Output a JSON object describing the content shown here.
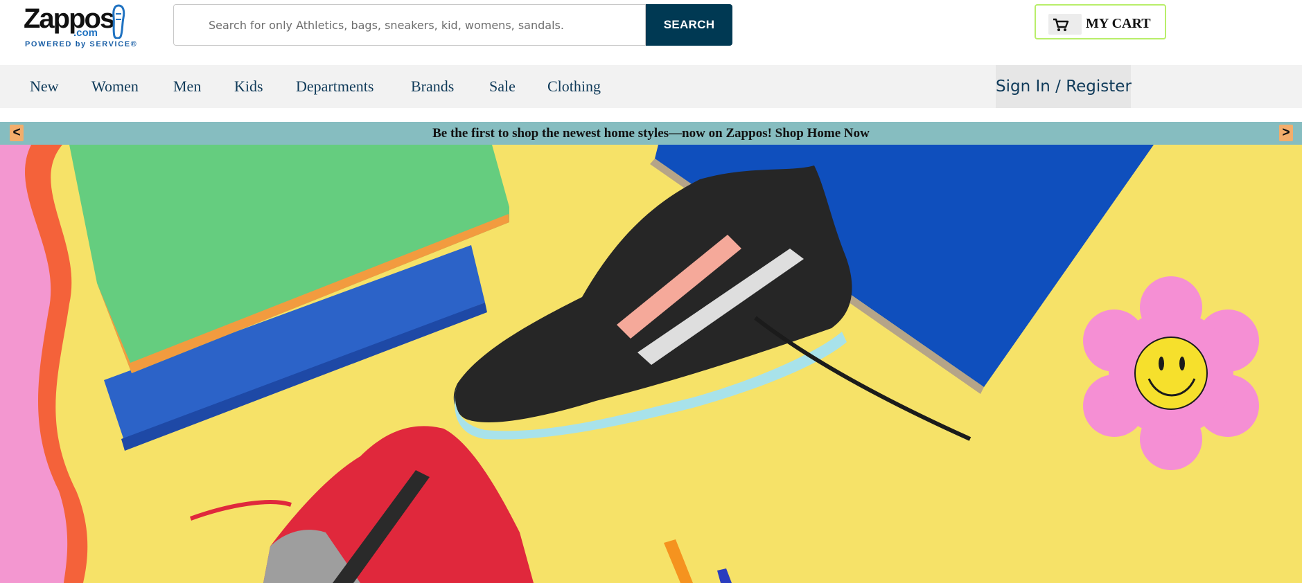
{
  "header": {
    "logo": {
      "word": "Zappos",
      "dotcom": ".com",
      "tagline": "POWERED by SERVICE®"
    },
    "search": {
      "placeholder": "Search for only Athletics, bags, sneakers, kid, womens, sandals.",
      "value": "",
      "button_label": "SEARCH"
    },
    "cart": {
      "label": "MY CART",
      "icon": "shopping-cart-icon"
    }
  },
  "nav": {
    "items": [
      {
        "label": "New"
      },
      {
        "label": "Women"
      },
      {
        "label": "Men"
      },
      {
        "label": "Kids"
      },
      {
        "label": "Departments"
      },
      {
        "label": "Brands"
      },
      {
        "label": "Sale"
      },
      {
        "label": "Clothing"
      }
    ],
    "sign_in_label": "Sign In / Register"
  },
  "promo": {
    "text": "Be the first to shop the newest home styles—now on Zappos! Shop Home Now",
    "prev_label": "<",
    "next_label": ">",
    "color": "#86bdc0"
  },
  "colors": {
    "search_button": "#003953",
    "nav_text": "#0f3a59",
    "cart_border": "#b8ee6a",
    "hero_background": "#f6e268"
  }
}
